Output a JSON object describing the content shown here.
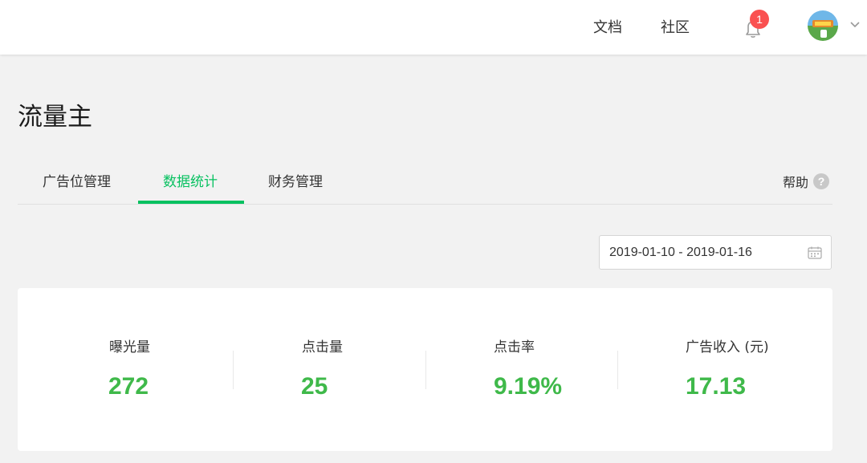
{
  "topbar": {
    "nav": [
      {
        "label": "文档"
      },
      {
        "label": "社区"
      }
    ],
    "notification": {
      "count": "1",
      "icon": "bell-icon"
    },
    "avatar": {
      "icon": "avatar-image"
    },
    "caret_icon": "chevron-down-icon"
  },
  "page": {
    "title": "流量主"
  },
  "tabs": {
    "items": [
      {
        "label": "广告位管理",
        "active": false
      },
      {
        "label": "数据统计",
        "active": true
      },
      {
        "label": "财务管理",
        "active": false
      }
    ],
    "help_label": "帮助",
    "help_icon": "question-mark-icon"
  },
  "date_range": {
    "value": "2019-01-10 - 2019-01-16",
    "icon": "calendar-icon"
  },
  "stats": [
    {
      "label": "曝光量",
      "value": "272"
    },
    {
      "label": "点击量",
      "value": "25"
    },
    {
      "label": "点击率",
      "value": "9.19%"
    },
    {
      "label": "广告收入 (元)",
      "value": "17.13"
    }
  ],
  "colors": {
    "accent": "#07c160",
    "value_green": "#3fb94a",
    "badge": "#fa5151"
  }
}
